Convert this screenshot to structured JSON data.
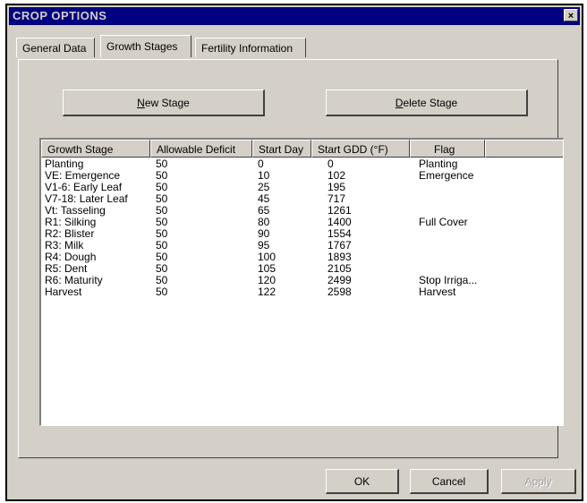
{
  "window": {
    "title": "CROP OPTIONS",
    "close_label": "×"
  },
  "tabs": [
    {
      "label": "General Data"
    },
    {
      "label": "Growth Stages",
      "active": true
    },
    {
      "label": "Fertility Information"
    }
  ],
  "buttons": {
    "new_stage": "New Stage",
    "delete_stage": "Delete Stage",
    "ok": "OK",
    "cancel": "Cancel",
    "apply": "Apply"
  },
  "table": {
    "columns": [
      "Growth Stage",
      "Allowable Deficit",
      "Start Day",
      "Start GDD (°F)",
      "Flag"
    ],
    "rows": [
      [
        "Planting",
        "50",
        "0",
        "0",
        "Planting"
      ],
      [
        "VE: Emergence",
        "50",
        "10",
        "102",
        "Emergence"
      ],
      [
        "V1-6: Early Leaf",
        "50",
        "25",
        "195",
        ""
      ],
      [
        "V7-18: Later Leaf",
        "50",
        "45",
        "717",
        ""
      ],
      [
        "Vt: Tasseling",
        "50",
        "65",
        "1261",
        ""
      ],
      [
        "R1: Silking",
        "50",
        "80",
        "1400",
        "Full Cover"
      ],
      [
        "R2: Blister",
        "50",
        "90",
        "1554",
        ""
      ],
      [
        "R3: Milk",
        "50",
        "95",
        "1767",
        ""
      ],
      [
        "R4: Dough",
        "50",
        "100",
        "1893",
        ""
      ],
      [
        "R5: Dent",
        "50",
        "105",
        "2105",
        ""
      ],
      [
        "R6: Maturity",
        "50",
        "120",
        "2499",
        "Stop Irriga..."
      ],
      [
        "Harvest",
        "50",
        "122",
        "2598",
        "Harvest"
      ]
    ]
  }
}
